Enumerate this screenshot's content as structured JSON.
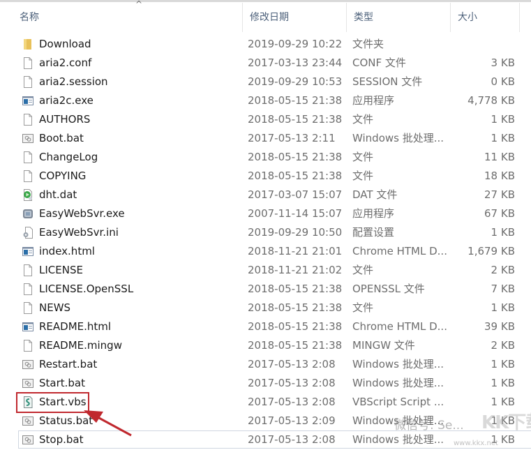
{
  "header": {
    "columns": {
      "name": "名称",
      "date": "修改日期",
      "type": "类型",
      "size": "大小"
    },
    "sort_indicator": "^"
  },
  "files": [
    {
      "name": "Download",
      "date": "2019-09-29 10:22",
      "type": "文件夹",
      "size": "",
      "icon": "folder-icon"
    },
    {
      "name": "aria2.conf",
      "date": "2017-03-13 23:44",
      "type": "CONF 文件",
      "size": "3 KB",
      "icon": "file-icon"
    },
    {
      "name": "aria2.session",
      "date": "2019-09-29 10:53",
      "type": "SESSION 文件",
      "size": "0 KB",
      "icon": "file-icon"
    },
    {
      "name": "aria2c.exe",
      "date": "2018-05-15 21:38",
      "type": "应用程序",
      "size": "4,778 KB",
      "icon": "exe-icon"
    },
    {
      "name": "AUTHORS",
      "date": "2018-05-15 21:38",
      "type": "文件",
      "size": "1 KB",
      "icon": "file-icon"
    },
    {
      "name": "Boot.bat",
      "date": "2017-05-13 2:11",
      "type": "Windows 批处理...",
      "size": "1 KB",
      "icon": "bat-icon"
    },
    {
      "name": "ChangeLog",
      "date": "2018-05-15 21:38",
      "type": "文件",
      "size": "11 KB",
      "icon": "file-icon"
    },
    {
      "name": "COPYING",
      "date": "2018-05-15 21:38",
      "type": "文件",
      "size": "18 KB",
      "icon": "file-icon"
    },
    {
      "name": "dht.dat",
      "date": "2017-03-07 15:07",
      "type": "DAT 文件",
      "size": "27 KB",
      "icon": "media-file-icon"
    },
    {
      "name": "EasyWebSvr.exe",
      "date": "2007-11-14 15:07",
      "type": "应用程序",
      "size": "67 KB",
      "icon": "app-icon"
    },
    {
      "name": "EasyWebSvr.ini",
      "date": "2019-09-29 10:50",
      "type": "配置设置",
      "size": "1 KB",
      "icon": "settings-file-icon"
    },
    {
      "name": "index.html",
      "date": "2018-11-21 21:01",
      "type": "Chrome HTML D...",
      "size": "1,679 KB",
      "icon": "html-icon"
    },
    {
      "name": "LICENSE",
      "date": "2018-11-21 21:02",
      "type": "文件",
      "size": "2 KB",
      "icon": "file-icon"
    },
    {
      "name": "LICENSE.OpenSSL",
      "date": "2018-05-15 21:38",
      "type": "OPENSSL 文件",
      "size": "7 KB",
      "icon": "file-icon"
    },
    {
      "name": "NEWS",
      "date": "2018-05-15 21:38",
      "type": "文件",
      "size": "1 KB",
      "icon": "file-icon"
    },
    {
      "name": "README.html",
      "date": "2018-05-15 21:38",
      "type": "Chrome HTML D...",
      "size": "39 KB",
      "icon": "html-icon"
    },
    {
      "name": "README.mingw",
      "date": "2018-05-15 21:38",
      "type": "MINGW 文件",
      "size": "2 KB",
      "icon": "file-icon"
    },
    {
      "name": "Restart.bat",
      "date": "2017-05-13 2:08",
      "type": "Windows 批处理...",
      "size": "1 KB",
      "icon": "bat-icon"
    },
    {
      "name": "Start.bat",
      "date": "2017-05-13 2:08",
      "type": "Windows 批处理...",
      "size": "1 KB",
      "icon": "bat-icon"
    },
    {
      "name": "Start.vbs",
      "date": "2017-05-13 2:08",
      "type": "VBScript Script ...",
      "size": "1 KB",
      "icon": "vbs-icon"
    },
    {
      "name": "Status.bat",
      "date": "2017-05-13 2:09",
      "type": "Windows 批处理...",
      "size": "1 KB",
      "icon": "bat-icon"
    },
    {
      "name": "Stop.bat",
      "date": "2017-05-13 2:08",
      "type": "Windows 批处理...",
      "size": "1 KB",
      "icon": "bat-icon"
    }
  ],
  "annotation": {
    "highlighted_file": "Start.vbs",
    "color": "#c0282e"
  },
  "watermark": {
    "text": "微信号: Se...",
    "logo": "KK下载",
    "url": "www.kkx.net"
  }
}
